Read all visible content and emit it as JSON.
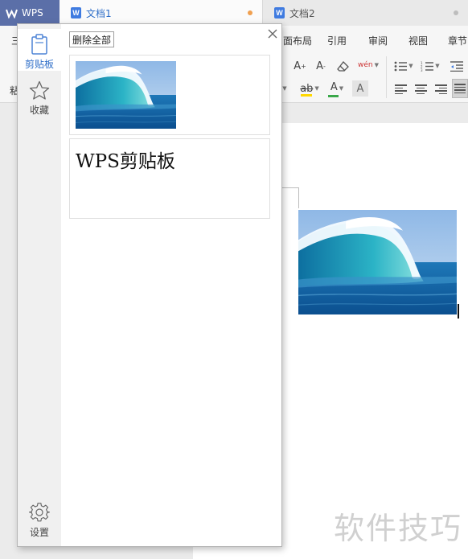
{
  "tabs": {
    "app": {
      "label": "WPS",
      "icon": "wps-logo-icon"
    },
    "docs": [
      {
        "label": "文档1",
        "active": true,
        "dot_color": "#f0a050"
      },
      {
        "label": "文档2",
        "active": false,
        "dot_color": "#bdbdbd"
      }
    ]
  },
  "ribbon": {
    "menu": [
      "面布局",
      "引用",
      "审阅",
      "视图",
      "章节"
    ],
    "left_partial": [
      "三",
      "粘"
    ],
    "pinyin_glyph": "wén",
    "icons": [
      "increase-font-icon",
      "decrease-font-icon",
      "clear-format-icon",
      "pinyin-guide-icon",
      "bullet-list-icon",
      "numbered-list-icon",
      "decrease-indent-icon",
      "highlight-icon",
      "font-color-icon",
      "char-shading-icon",
      "align-left-icon",
      "align-center-icon",
      "align-right-icon",
      "justify-icon"
    ],
    "colors": {
      "font_color_bar": "#e03030",
      "highlight_bar": "#ffd800"
    }
  },
  "clipboard_panel": {
    "nav": [
      {
        "label": "剪贴板",
        "icon": "clipboard-icon",
        "active": true
      },
      {
        "label": "收藏",
        "icon": "star-icon",
        "active": false
      },
      {
        "label": "设置",
        "icon": "gear-icon",
        "active": false
      }
    ],
    "delete_all_label": "删除全部",
    "items": [
      {
        "type": "image",
        "description_icon": "wave-image"
      },
      {
        "type": "text",
        "text": "WPS剪贴板"
      }
    ]
  },
  "watermark": "软件技巧",
  "colors": {
    "accent": "#2e6ec8",
    "app_tab": "#5b6fa8"
  }
}
